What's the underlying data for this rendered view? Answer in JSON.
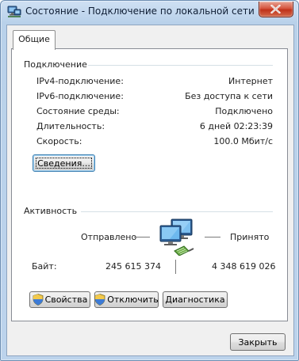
{
  "window": {
    "title": "Состояние - Подключение по локальной сети",
    "icon": "network-status-icon",
    "close_icon": "close-icon"
  },
  "tabs": [
    {
      "label": "Общие",
      "selected": true
    }
  ],
  "connection": {
    "group_title": "Подключение",
    "rows": [
      {
        "label": "IPv4-подключение:",
        "value": "Интернет"
      },
      {
        "label": "IPv6-подключение:",
        "value": "Без доступа к сети"
      },
      {
        "label": "Состояние среды:",
        "value": "Подключено"
      },
      {
        "label": "Длительность:",
        "value": "6 дней 02:23:39"
      },
      {
        "label": "Скорость:",
        "value": "100.0 Мбит/с"
      }
    ],
    "details_button": "Сведения..."
  },
  "activity": {
    "group_title": "Активность",
    "sent_label": "Отправлено",
    "received_label": "Принято",
    "bytes_label": "Байт:",
    "bytes_sent": "245 615 374",
    "bytes_received": "4 348 619 026",
    "icon": "network-computers-icon"
  },
  "buttons": {
    "properties": "Свойства",
    "disable": "Отключить",
    "diagnose": "Диагностика",
    "close": "Закрыть"
  },
  "colors": {
    "titlebar": "#bcd3ec",
    "close_button": "#c0321a",
    "panel": "#ffffff",
    "dialog_bg": "#f0f0f0"
  }
}
